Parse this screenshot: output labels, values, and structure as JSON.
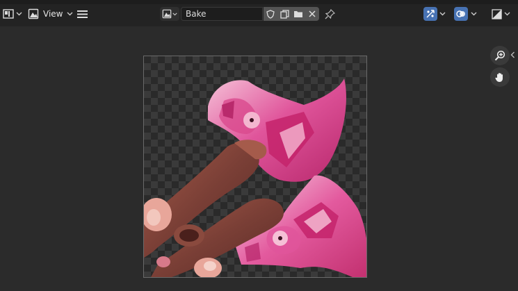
{
  "header": {
    "editor_type_icon": "image-editor-icon",
    "view_label": "View",
    "image_name": "Bake"
  },
  "icons": {
    "menu": "hamburger-icon",
    "image": "image-icon",
    "fake_user": "shield-icon",
    "duplicate": "duplicate-icon",
    "open": "folder-icon",
    "unlink": "close-icon",
    "pin": "pin-icon",
    "uv_sync": "uv-sync-icon",
    "overlays": "overlays-icon",
    "display_channels": "display-channels-icon",
    "zoom": "zoom-in-icon",
    "pan": "hand-icon",
    "sidebar_toggle": "chevron-left-icon"
  },
  "colors": {
    "accent_blue": "#4772b3",
    "texture_pink": "#e0559b",
    "texture_brown": "#7a3f36"
  }
}
